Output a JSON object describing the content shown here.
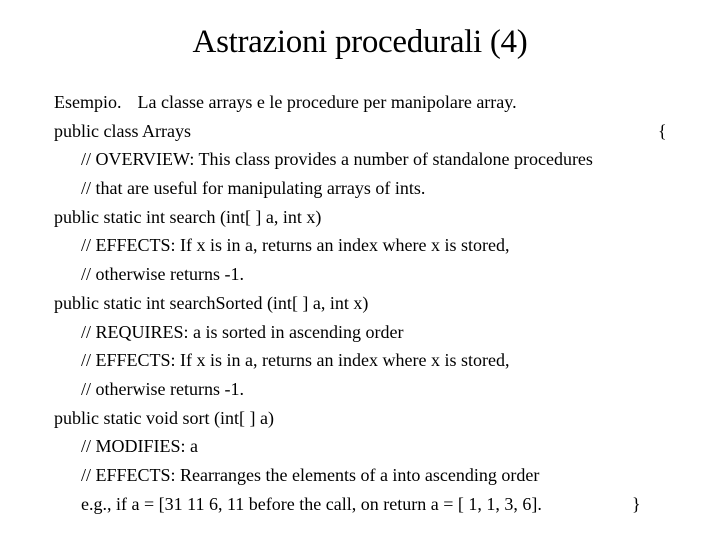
{
  "slide": {
    "title": "Astrazioni procedurali (4)"
  },
  "body": {
    "intro_label": "Esempio.",
    "intro_text": "La classe arrays e le procedure per manipolare array.",
    "class_decl": "public class Arrays",
    "open_brace": "{",
    "overview_1": "// OVERVIEW: This class provides a number of standalone procedures",
    "overview_2": "// that are useful for manipulating arrays of ints.",
    "search_sig": "public static int search (int[ ] a, int x)",
    "search_effects_1": "// EFFECTS: If x is in a, returns an index where x is stored,",
    "search_effects_2": "// otherwise returns -1.",
    "sorted_sig": "public static int searchSorted (int[ ] a, int x)",
    "sorted_requires": "// REQUIRES: a is sorted in ascending order",
    "sorted_effects_1": "// EFFECTS: If x is in a, returns an index where x is stored,",
    "sorted_effects_2": "// otherwise returns -1.",
    "sort_sig": "public static void sort (int[ ] a)",
    "sort_modifies": "// MODIFIES: a",
    "sort_effects": "// EFFECTS: Rearranges the elements of a into ascending order",
    "sort_example": "e.g., if a = [31 11 6, 11 before the call, on return a = [ 1, 1, 3, 6].",
    "close_brace": "}"
  }
}
